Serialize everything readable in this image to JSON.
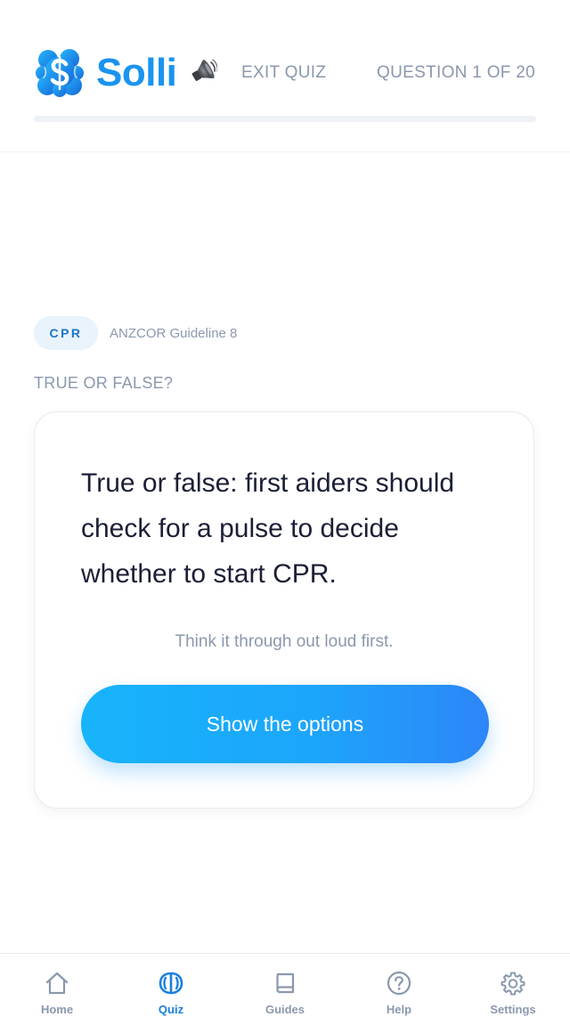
{
  "header": {
    "brand": "Solli",
    "exit_label": "EXIT QUIZ",
    "question_counter": "QUESTION 1 OF 20",
    "progress_fraction": 0.0
  },
  "question": {
    "category": "CPR",
    "guideline": "ANZCOR Guideline 8",
    "type_label": "TRUE OR FALSE?",
    "text": "True or false: first aiders should check for a pulse to decide whether to start CPR.",
    "hint": "Think it through out loud first.",
    "button_label": "Show the options"
  },
  "tabbar": {
    "tabs": [
      {
        "label": "Home",
        "icon": "home-icon",
        "active": false
      },
      {
        "label": "Quiz",
        "icon": "quiz-icon",
        "active": true
      },
      {
        "label": "Guides",
        "icon": "book-icon",
        "active": false
      },
      {
        "label": "Help",
        "icon": "help-icon",
        "active": false
      },
      {
        "label": "Settings",
        "icon": "gear-icon",
        "active": false
      }
    ]
  },
  "colors": {
    "brand": "#1a94f0",
    "muted": "#8a98ad",
    "inactive_tab": "#8a98ad",
    "active_tab": "#1a7fe0",
    "button_start": "#17b4fb",
    "button_end": "#2d86f8"
  }
}
